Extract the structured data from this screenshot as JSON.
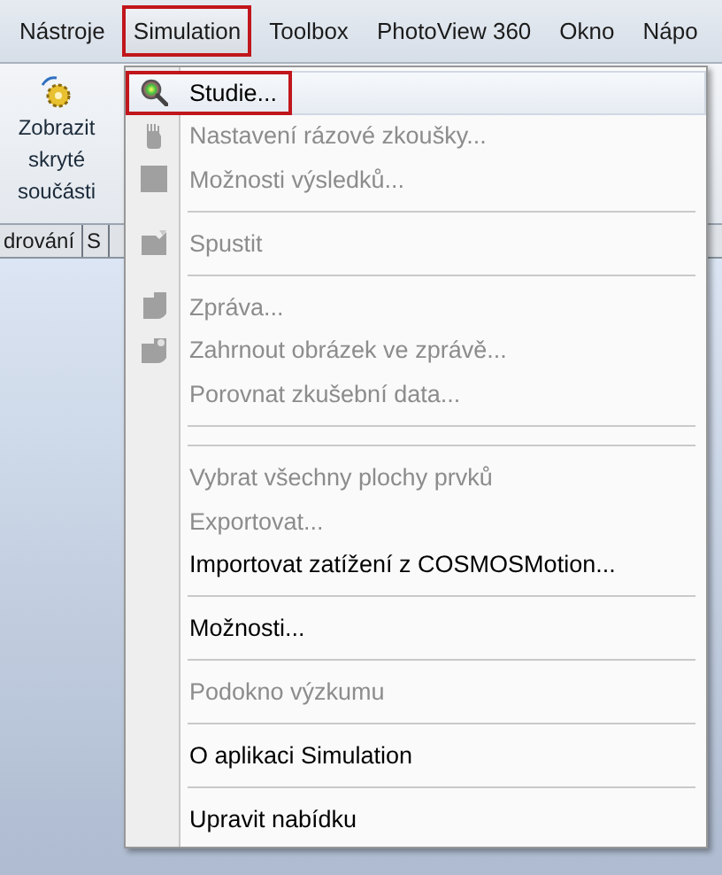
{
  "menu_bar": [
    {
      "label": "Nástroje",
      "selected": false
    },
    {
      "label": "Simulation",
      "selected": true
    },
    {
      "label": "Toolbox",
      "selected": false
    },
    {
      "label": "PhotoView 360",
      "selected": false
    },
    {
      "label": "Okno",
      "selected": false
    },
    {
      "label": "Nápo",
      "selected": false
    }
  ],
  "ribbon": {
    "button_lines": [
      "Zobrazit",
      "skryté",
      "součásti"
    ]
  },
  "tabs": [
    {
      "label": "drování"
    },
    {
      "label": "S"
    }
  ],
  "menu": [
    {
      "kind": "study",
      "label": "Studie...",
      "disabled": false,
      "selected": true
    },
    {
      "kind": "shock",
      "label": "Nastavení rázové zkoušky...",
      "disabled": true,
      "selected": false
    },
    {
      "kind": "results",
      "label": "Možnosti výsledků...",
      "disabled": true,
      "selected": false
    },
    {
      "kind": "separator"
    },
    {
      "kind": "run",
      "label": "Spustit",
      "disabled": true,
      "selected": false
    },
    {
      "kind": "separator"
    },
    {
      "kind": "report",
      "label": "Zpráva...",
      "disabled": true,
      "selected": false
    },
    {
      "kind": "image",
      "label": "Zahrnout obrázek ve zprávě...",
      "disabled": true,
      "selected": false
    },
    {
      "kind": "item",
      "label": "Porovnat zkušební data...",
      "disabled": true,
      "selected": false
    },
    {
      "kind": "separator"
    },
    {
      "kind": "separator"
    },
    {
      "kind": "item",
      "label": "Vybrat všechny plochy prvků",
      "disabled": true,
      "selected": false
    },
    {
      "kind": "item",
      "label": "Exportovat...",
      "disabled": true,
      "selected": false
    },
    {
      "kind": "item",
      "label": "Importovat zatížení z COSMOSMotion...",
      "disabled": false,
      "selected": false
    },
    {
      "kind": "separator"
    },
    {
      "kind": "item",
      "label": "Možnosti...",
      "disabled": false,
      "selected": false
    },
    {
      "kind": "separator"
    },
    {
      "kind": "item",
      "label": "Podokno výzkumu",
      "disabled": true,
      "selected": false
    },
    {
      "kind": "separator"
    },
    {
      "kind": "item",
      "label": "O aplikaci Simulation",
      "disabled": false,
      "selected": false
    },
    {
      "kind": "separator"
    },
    {
      "kind": "item",
      "label": "Upravit nabídku",
      "disabled": false,
      "selected": false
    }
  ]
}
